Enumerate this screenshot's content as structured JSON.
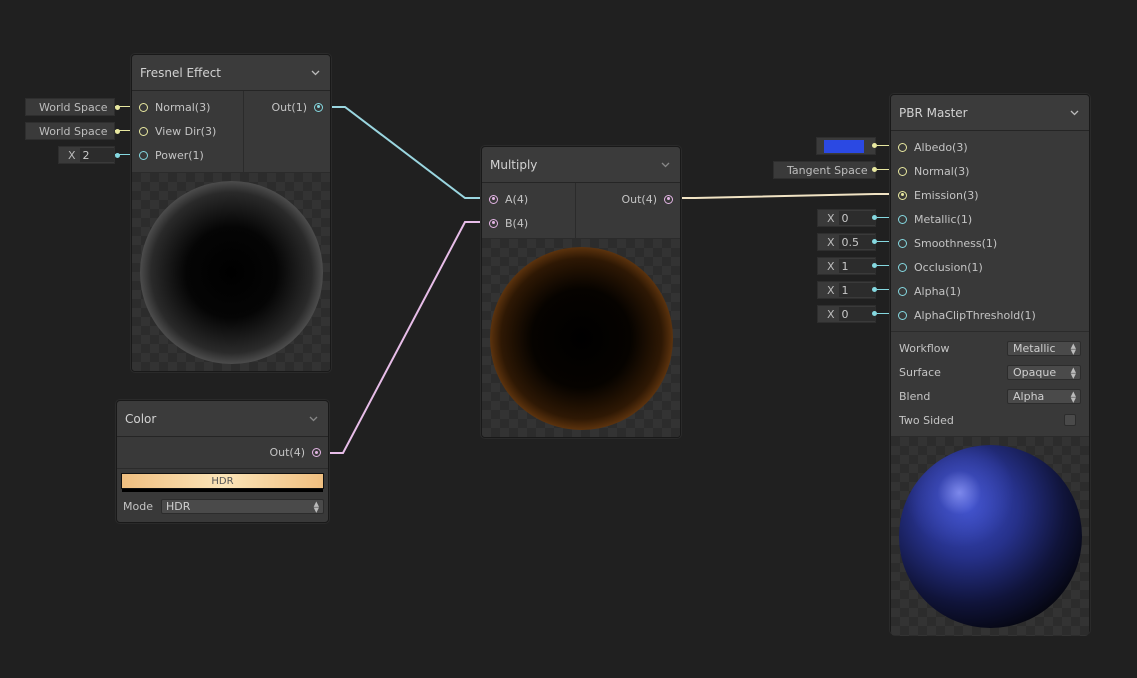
{
  "fresnel": {
    "title": "Fresnel Effect",
    "inputs": [
      "Normal(3)",
      "View Dir(3)",
      "Power(1)"
    ],
    "output": "Out(1)",
    "slots": {
      "normal": "World Space",
      "viewdir": "World Space",
      "power_prefix": "X",
      "power_value": "2"
    }
  },
  "color": {
    "title": "Color",
    "output": "Out(4)",
    "swatch_label": "HDR",
    "mode_label": "Mode",
    "mode_value": "HDR"
  },
  "multiply": {
    "title": "Multiply",
    "inputs": [
      "A(4)",
      "B(4)"
    ],
    "output": "Out(4)"
  },
  "pbr": {
    "title": "PBR Master",
    "inputs": [
      "Albedo(3)",
      "Normal(3)",
      "Emission(3)",
      "Metallic(1)",
      "Smoothness(1)",
      "Occlusion(1)",
      "Alpha(1)",
      "AlphaClipThreshold(1)"
    ],
    "slots": {
      "albedo_color": "#2b49e3",
      "normal": "Tangent Space",
      "prefix": "X",
      "metallic": "0",
      "smoothness": "0.5",
      "occlusion": "1",
      "alpha": "1",
      "alphaclip": "0"
    },
    "settings": [
      {
        "label": "Workflow",
        "value": "Metallic"
      },
      {
        "label": "Surface",
        "value": "Opaque"
      },
      {
        "label": "Blend",
        "value": "Alpha"
      }
    ],
    "two_sided_label": "Two Sided",
    "two_sided_checked": false
  },
  "colors": {
    "vector3": "#e8e8a0",
    "vector1": "#85d8e0",
    "vector4": "#e3b5e4",
    "background": "#202020"
  }
}
